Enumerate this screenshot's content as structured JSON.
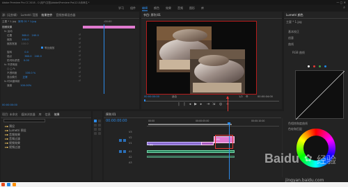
{
  "titlebar": {
    "text": "Adobe Premiere Pro CC 2018 - C:\\用户\\文档\\Adobe\\Premiere Pro\\12.0\\未命名 *"
  },
  "workspaces": [
    "学习",
    "组件",
    "编辑",
    "颜色",
    "效果",
    "音频",
    "图形",
    "库"
  ],
  "effect_controls": {
    "tabs": [
      "源: (无剪辑)",
      "Lumetri 范围",
      "效果控件",
      "音频剪辑混合器"
    ],
    "header": "主要 * 1.jpg",
    "clip": "序列 01 * 1.jpg",
    "timecode_right": ":00:00",
    "sections": [
      "视频效果",
      "fx 运动",
      "位置",
      "缩放",
      "缩放宽度",
      "等比缩放",
      "旋转",
      "锚点",
      "防闪烁滤镜",
      "fx 不透明度",
      "蒙版",
      "不透明度",
      "混合模式",
      "fx 时间重映射",
      "速度"
    ],
    "values": [
      "360.0",
      "240.0",
      "100.0",
      "100.0",
      "0.0",
      "360.0",
      "240.0",
      "0.00",
      "100.0 %",
      "正常",
      "100.00%"
    ],
    "checkbox_label": "等比缩放",
    "time": "00:00:00:00"
  },
  "program_monitor": {
    "title": "节目: 序列 01",
    "timecode_left": "00:00:00:00",
    "fit": "适合",
    "quality": "1/2",
    "timecode_right": "00:00:04:00"
  },
  "lumetri": {
    "title": "Lumetri 颜色",
    "header": "主要 * 1.jpg",
    "sections": [
      "基本校正",
      "创意",
      "曲线",
      "RGB 曲线",
      "色相饱和度曲线"
    ],
    "bottom": "色轮和匹配"
  },
  "project": {
    "tabs": [
      "项目: 未命名",
      "媒体浏览器",
      "库",
      "信息",
      "效果"
    ],
    "items": [
      "预设",
      "Lumetri 预设",
      "音频效果",
      "音频过渡",
      "视频效果",
      "视频过渡"
    ]
  },
  "timeline": {
    "title": "序列 01",
    "timecode": "00:00:00:00",
    "ruler": [
      "00:00",
      "00:00:05:00",
      "00:00:10:00"
    ],
    "video_tracks": [
      "V3",
      "V2",
      "V1"
    ],
    "audio_tracks": [
      "A1",
      "A2",
      "A3"
    ],
    "clips": [
      "1.jpg",
      "2.jpg"
    ]
  },
  "watermark": {
    "brand": "Baidu",
    "subtitle": "经验",
    "url": "jingyan.baidu.com"
  },
  "colors": {
    "accent": "#2d8ceb",
    "playhead": "#e53935",
    "video_clip": "#8a6ad0",
    "pink_clip": "#e07ad0",
    "audio_clip": "#2c8a62"
  }
}
